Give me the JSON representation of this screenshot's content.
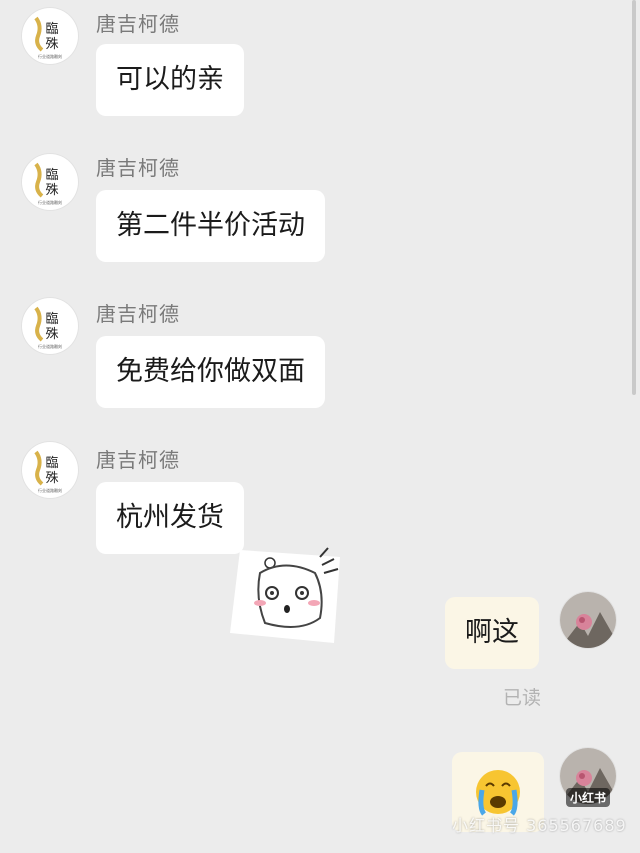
{
  "contact": {
    "name": "唐吉柯德",
    "avatar_text": "臨 殊",
    "avatar_caption": "行业道路雕刻"
  },
  "messages": [
    {
      "sender": "唐吉柯德",
      "text": "可以的亲"
    },
    {
      "sender": "唐吉柯德",
      "text": "第二件半价活动"
    },
    {
      "sender": "唐吉柯德",
      "text": "免费给你做双面"
    },
    {
      "sender": "唐吉柯德",
      "text": "杭州发货"
    }
  ],
  "incoming_sticker": "surprised-cartoon-sticker",
  "my_messages": [
    {
      "text": "啊这",
      "status": "已读"
    },
    {
      "emoji": "😭"
    }
  ],
  "watermark": {
    "logo": "小红书",
    "text": "小红书号 365567689"
  },
  "colors": {
    "background": "#ececec",
    "incoming_bubble": "#ffffff",
    "outgoing_bubble": "#fbf6e6",
    "read_status": "#b3b3b3"
  }
}
